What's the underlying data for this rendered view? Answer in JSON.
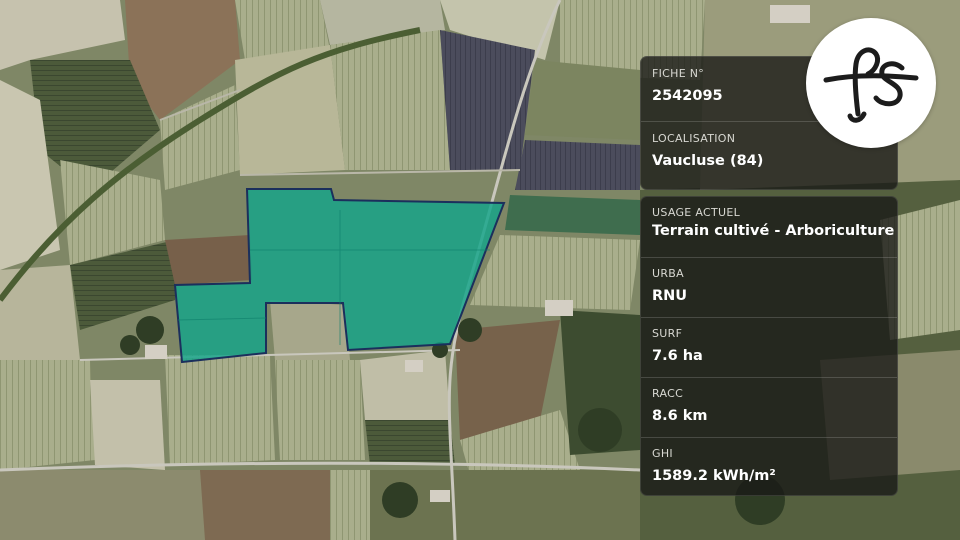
{
  "map": {
    "colors": {
      "parcel_fill": "#14a58a",
      "parcel_stroke": "#1b2f5c",
      "field_dark": "#3e4a32",
      "field_light": "#b9bca0",
      "road": "#c9c7bd"
    }
  },
  "logo": {
    "text": "fs",
    "icon": "fs-monogram-logo"
  },
  "info_top": [
    {
      "label": "FICHE N°",
      "value": "2542095"
    },
    {
      "label": "LOCALISATION",
      "value": "Vaucluse (84)"
    }
  ],
  "info_bottom": [
    {
      "label": "USAGE ACTUEL",
      "value": "Terrain cultivé - Arboriculture"
    },
    {
      "label": "URBA",
      "value": "RNU"
    },
    {
      "label": "SURF",
      "value": "7.6 ha"
    },
    {
      "label": "RACC",
      "value": "8.6 km"
    },
    {
      "label": "GHI",
      "value": "1589.2 kWh/m²"
    }
  ]
}
